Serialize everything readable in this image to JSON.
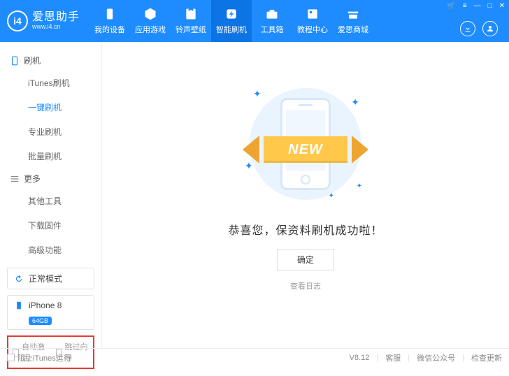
{
  "app": {
    "name": "爱思助手",
    "url": "www.i4.cn",
    "logo_text": "i4"
  },
  "window": {
    "cart": "🛒",
    "menu": "≡",
    "min": "—",
    "max": "□",
    "close": "✕"
  },
  "nav": [
    {
      "label": "我的设备",
      "icon": "device"
    },
    {
      "label": "应用游戏",
      "icon": "apps"
    },
    {
      "label": "铃声壁纸",
      "icon": "media"
    },
    {
      "label": "智能刷机",
      "icon": "flash",
      "active": true
    },
    {
      "label": "工具箱",
      "icon": "tools"
    },
    {
      "label": "教程中心",
      "icon": "book"
    },
    {
      "label": "爱思商城",
      "icon": "shop"
    }
  ],
  "sidebar": {
    "group1": {
      "title": "刷机",
      "items": [
        "iTunes刷机",
        "一键刷机",
        "专业刷机",
        "批量刷机"
      ],
      "active_index": 1
    },
    "group2": {
      "title": "更多",
      "items": [
        "其他工具",
        "下载固件",
        "高级功能"
      ]
    },
    "mode": "正常模式",
    "device": {
      "name": "iPhone 8",
      "storage": "64GB"
    },
    "checks": {
      "auto_activate": "自动激活",
      "skip_guide": "跳过向导"
    }
  },
  "main": {
    "ribbon": "NEW",
    "success": "恭喜您，保资料刷机成功啦！",
    "ok": "确定",
    "view_log": "查看日志"
  },
  "footer": {
    "block_itunes": "阻止iTunes运行",
    "version": "V8.12",
    "links": [
      "客服",
      "微信公众号",
      "检查更新"
    ]
  }
}
